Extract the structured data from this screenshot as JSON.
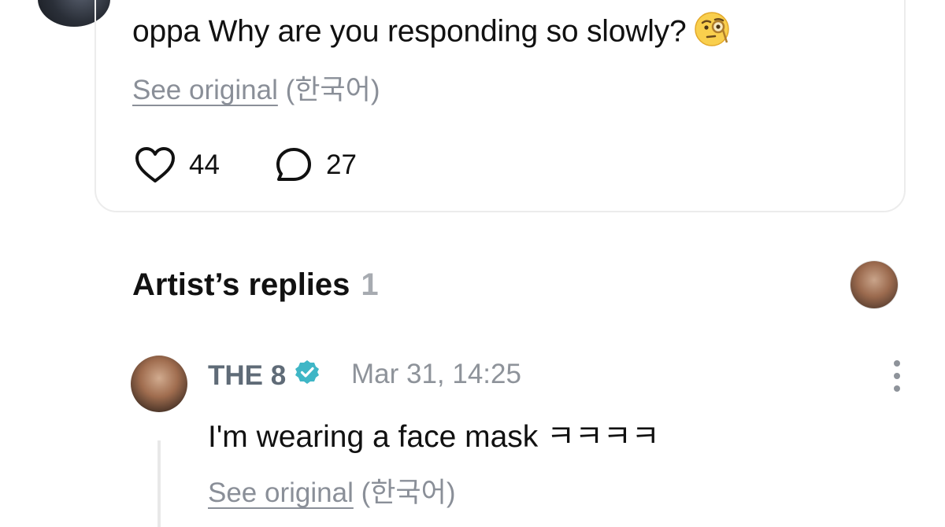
{
  "post": {
    "text": "oppa Why are you responding so slowly?",
    "emoji": "face-with-monocle",
    "see_original": "See original",
    "language": "(한국어)",
    "likes": "44",
    "comments": "27"
  },
  "artist_replies": {
    "title": "Artist’s replies",
    "count": "1"
  },
  "reply": {
    "author": "THE 8",
    "timestamp": "Mar 31, 14:25",
    "text": "I'm wearing a face mask ㅋㅋㅋㅋ",
    "see_original": "See original",
    "language": "(한국어)"
  },
  "colors": {
    "verified": "#3fb6c6",
    "muted_text": "#8a8f98",
    "author_name": "#5f6b77"
  }
}
